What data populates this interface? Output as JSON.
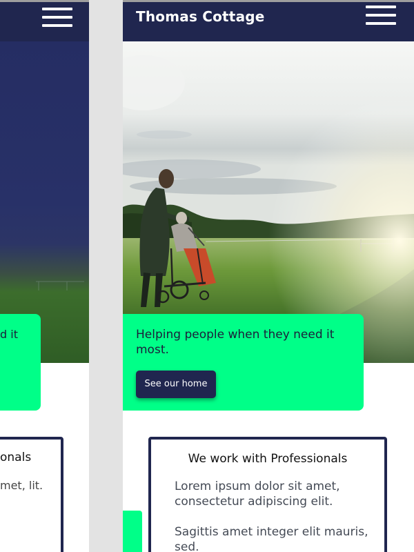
{
  "header": {
    "site_title": "Thomas Cottage",
    "menu_icon": "hamburger-menu-icon"
  },
  "hero": {
    "image_description": "person-pushing-wheelchair-in-field"
  },
  "cta": {
    "text": "Helping people when they need it most.",
    "button_label": "See our home"
  },
  "professionals": {
    "title": "We work with Professionals",
    "paragraph_1": "Lorem ipsum dolor sit amet, consectetur adipiscing elit.",
    "paragraph_2": "Sagittis amet integer elit mauris, sed."
  },
  "left_preview": {
    "card_text_fragment": "d it",
    "title_fragment": "onals",
    "body_fragment": "met, lit."
  },
  "colors": {
    "navy": "#20264f",
    "accent_green": "#00ff88",
    "gap_gray": "#e3e3e3"
  }
}
